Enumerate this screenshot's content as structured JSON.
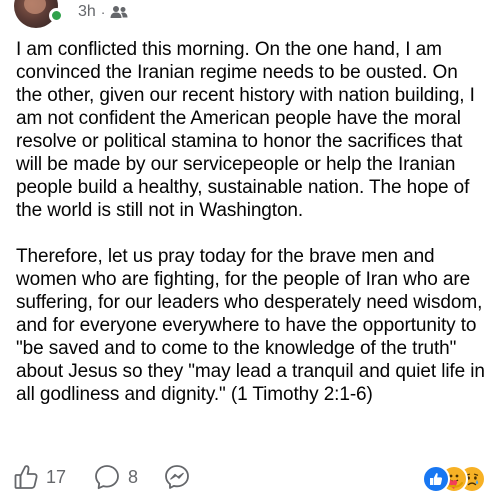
{
  "header": {
    "time": "3h",
    "separator": "·",
    "audience_icon": "friends-icon"
  },
  "post": {
    "paragraphs": [
      "I am conflicted this morning. On the one hand, I am convinced the Iranian regime needs to be ousted. On the other, given our recent history with nation building, I am not confident the American people have the moral resolve or political stamina to honor the sacrifices that will be made by our servicepeople or help the Iranian people build a healthy, sustainable nation. The hope of the world is still not in Washington.",
      "Therefore, let us pray today for the brave men and women who are fighting, for the people of Iran who are suffering, for our leaders who desperately need wisdom, and for everyone everywhere to have the opportunity to \"be saved and to come to the knowledge of the truth\" about Jesus so they \"may lead a tranquil and quiet life in all godliness and dignity.\" (1 Timothy 2:1-6)"
    ]
  },
  "actions": {
    "like_count": "17",
    "comment_count": "8",
    "like_icon": "thumbs-up-icon",
    "comment_icon": "comment-icon",
    "share_icon": "messenger-icon"
  },
  "reactions": {
    "icons": [
      "like-reaction-icon",
      "care-reaction-icon",
      "sad-reaction-icon"
    ],
    "colors": {
      "like": "#1877f2",
      "care": "#f7b125",
      "sad": "#f7b125"
    }
  },
  "colors": {
    "text": "#050505",
    "secondary": "#65676b",
    "online": "#31a24c"
  }
}
